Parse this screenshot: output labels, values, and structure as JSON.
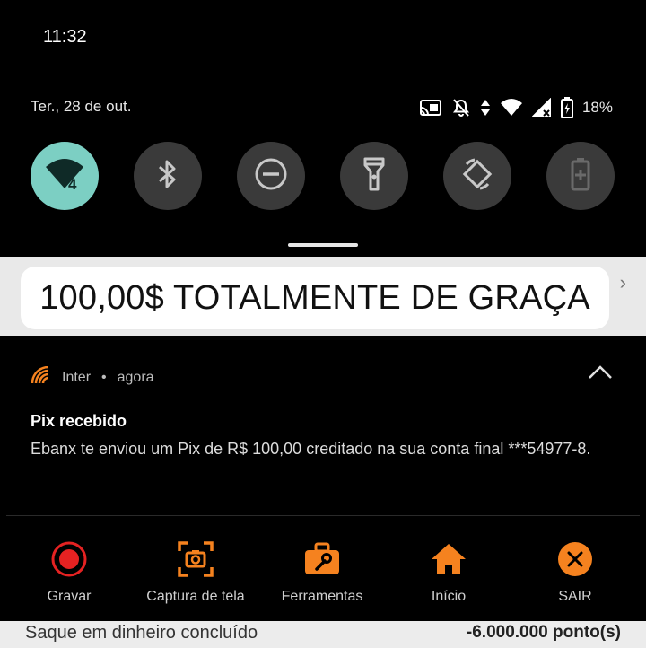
{
  "status_bar": {
    "time": "11:32"
  },
  "quick_settings": {
    "date": "Ter., 28 de out.",
    "battery_percent": "18%",
    "signal_badge": "4",
    "tiles": [
      {
        "name": "wifi",
        "icon": "wifi-icon",
        "active": true
      },
      {
        "name": "bluetooth",
        "icon": "bluetooth-icon",
        "active": false
      },
      {
        "name": "do-not-disturb",
        "icon": "do-not-disturb-icon",
        "active": false
      },
      {
        "name": "flashlight",
        "icon": "flashlight-icon",
        "active": false
      },
      {
        "name": "auto-rotate",
        "icon": "auto-rotate-icon",
        "active": false
      },
      {
        "name": "battery-saver",
        "icon": "battery-saver-icon",
        "active": false
      }
    ],
    "active_color": "#7ccfc3"
  },
  "banner": {
    "text": "100,00$ TOTALMENTE DE GRAÇA"
  },
  "notification": {
    "app_name": "Inter",
    "separator": "•",
    "time": "agora",
    "title": "Pix recebido",
    "body": "Ebanx te enviou um Pix de R$ 100,00 creditado na sua conta final ***54977-8.",
    "actions": [
      {
        "label": "Gravar",
        "icon": "record-icon"
      },
      {
        "label": "Captura de tela",
        "icon": "screenshot-icon"
      },
      {
        "label": "Ferramentas",
        "icon": "toolbox-icon"
      },
      {
        "label": "Início",
        "icon": "home-icon"
      },
      {
        "label": "SAIR",
        "icon": "exit-icon"
      }
    ],
    "accent_color": "#f5821f",
    "record_color": "#e52222"
  },
  "background_content": {
    "label": "Saque em dinheiro concluído",
    "value": "-6.000.000 ponto(s)"
  }
}
